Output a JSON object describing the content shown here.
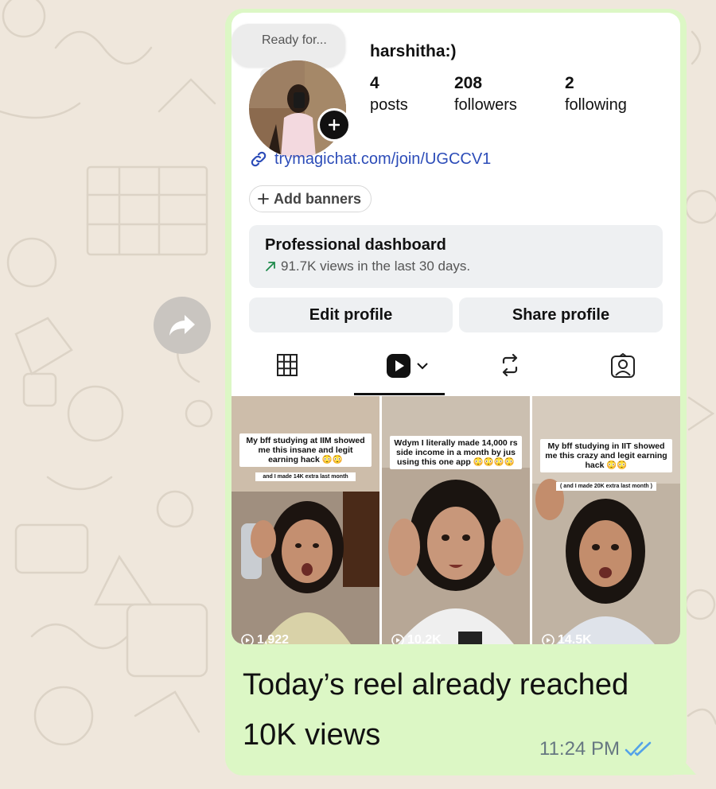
{
  "story_note": {
    "text": "Ready for..."
  },
  "profile": {
    "username": "harshitha:)",
    "stats": [
      {
        "value": "4",
        "label": "posts"
      },
      {
        "value": "208",
        "label": "followers"
      },
      {
        "value": "2",
        "label": "following"
      }
    ],
    "link": "trymagichat.com/join/UGCCV1",
    "add_banners_label": "Add banners"
  },
  "dashboard": {
    "title": "Professional dashboard",
    "subtitle": "91.7K views in the last 30 days."
  },
  "buttons": {
    "edit": "Edit profile",
    "share": "Share profile"
  },
  "tabs": [
    {
      "icon": "grid-icon"
    },
    {
      "icon": "reels-icon",
      "active": true
    },
    {
      "icon": "reposts-icon"
    },
    {
      "icon": "tagged-icon"
    }
  ],
  "reels": [
    {
      "caption": "My bff studying at IIM showed me this insane and legit earning hack 😳😳",
      "subcaption": "and I made 14K extra last month",
      "views": "1,922"
    },
    {
      "caption": "Wdym I literally made 14,000 rs side income in a month by jus using this one app 😳😳😳😳",
      "subcaption": "",
      "views": "10.2K"
    },
    {
      "caption": "My bff studying in IIT showed me this crazy and legit earning hack 😳😳",
      "subcaption": "( and I made 20K extra last month )",
      "views": "14.5K"
    }
  ],
  "message": {
    "text": "Today’s reel already reached 10K views",
    "time": "11:24 PM"
  },
  "colors": {
    "bubble": "#dcf7c5",
    "link": "#2c4cb8",
    "read_ticks": "#53a2e8",
    "wallpaper": "#efe7dc"
  }
}
